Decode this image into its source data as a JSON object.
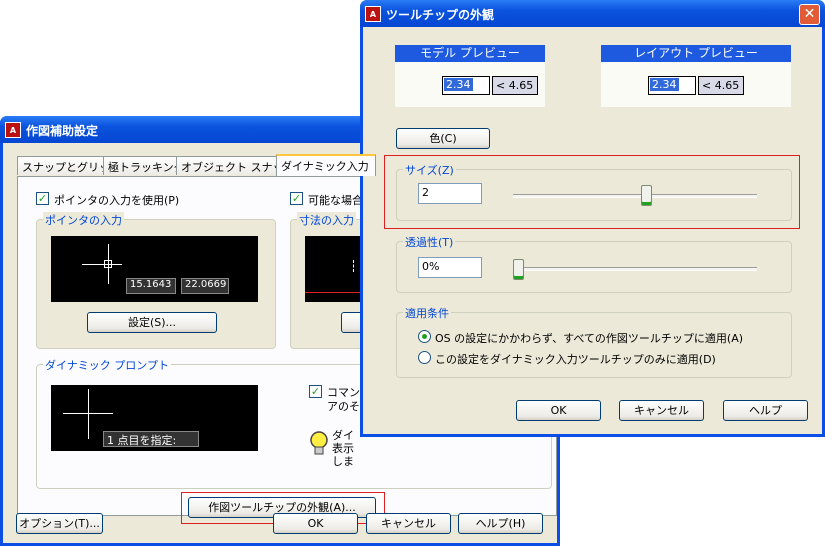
{
  "left_dialog": {
    "title": "作図補助設定",
    "tabs": [
      "スナップとグリッド",
      "極トラッキング",
      "オブジェクト スナップ",
      "ダイナミック入力"
    ],
    "pointer_input_checkbox": "ポインタの入力を使用(P)",
    "possible_checkbox": "可能な場合",
    "pointer_input_group": "ポインタの入力",
    "dimension_input_group": "寸法の入力",
    "preview_values": [
      "15.1643",
      "22.0669"
    ],
    "settings_button": "設定(S)...",
    "dynamic_prompt_group": "ダイナミック プロンプト",
    "prompt_text": "1 点目を指定:",
    "command_checkbox_line1": "コマンド",
    "command_checkbox_line2": "アのそば",
    "hint_line1": "ダイ",
    "hint_line2": "表示",
    "hint_line3": "しま",
    "tooltip_appearance_button": "作図ツールチップの外観(A)...",
    "options_button": "オプション(T)...",
    "ok_button": "OK",
    "cancel_button": "キャンセル",
    "help_button": "ヘルプ(H)"
  },
  "right_dialog": {
    "title": "ツールチップの外観",
    "model_preview_label": "モデル プレビュー",
    "layout_preview_label": "レイアウト プレビュー",
    "preview_value": "2.34",
    "preview_angle": "< 4.65",
    "color_button": "色(C)",
    "size_group": "サイズ(Z)",
    "size_value": "2",
    "size_slider_fraction": 0.55,
    "transparency_group": "透過性(T)",
    "transparency_value": "0%",
    "transparency_slider_fraction": 0.0,
    "apply_group": "適用条件",
    "apply_option_1": "OS の設定にかかわらず、すべての作図ツールチップに適用(A)",
    "apply_option_2": "この設定をダイナミック入力ツールチップのみに適用(D)",
    "ok_button": "OK",
    "cancel_button": "キャンセル",
    "help_button": "ヘルプ"
  },
  "colors": {
    "title_bar": "#0a52dd",
    "dialog_face": "#ece9d8",
    "preview_header": "#1d5ae0",
    "highlight_frame": "#e02020"
  }
}
